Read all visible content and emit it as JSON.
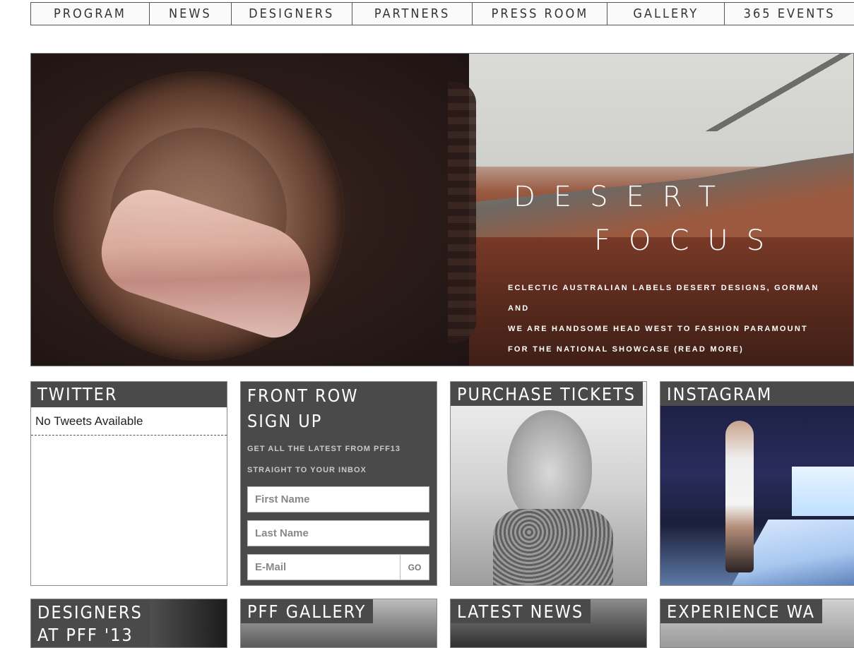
{
  "nav": {
    "items": [
      {
        "label": "PROGRAM"
      },
      {
        "label": "NEWS"
      },
      {
        "label": "DESIGNERS"
      },
      {
        "label": "PARTNERS"
      },
      {
        "label": "PRESS ROOM"
      },
      {
        "label": "GALLERY"
      },
      {
        "label": "365 EVENTS"
      }
    ]
  },
  "hero": {
    "title_line1": "DESERT",
    "title_line2": "FOCUS",
    "caption_line1": "ECLECTIC AUSTRALIAN LABELS DESERT DESIGNS, GORMAN AND",
    "caption_line2": "WE ARE HANDSOME HEAD WEST TO FASHION PARAMOUNT",
    "caption_line3": "FOR THE NATIONAL SHOWCASE (READ MORE)"
  },
  "twitter": {
    "title": "TWITTER",
    "message": "No Tweets Available"
  },
  "front_row": {
    "title_line1": "FRONT ROW",
    "title_line2": "SIGN UP",
    "sub_line1": "GET ALL THE LATEST FROM PFF13",
    "sub_line2": "STRAIGHT TO YOUR INBOX",
    "first_name_placeholder": "First Name",
    "last_name_placeholder": "Last Name",
    "email_placeholder": "E-Mail",
    "go_label": "GO"
  },
  "tickets": {
    "title": "PURCHASE TICKETS"
  },
  "instagram": {
    "title": "INSTAGRAM"
  },
  "designers": {
    "title_line1": "DESIGNERS",
    "title_line2": "AT PFF '13"
  },
  "gallery": {
    "title": "PFF GALLERY"
  },
  "news": {
    "title": "LATEST NEWS"
  },
  "experience": {
    "title": "EXPERIENCE WA"
  }
}
